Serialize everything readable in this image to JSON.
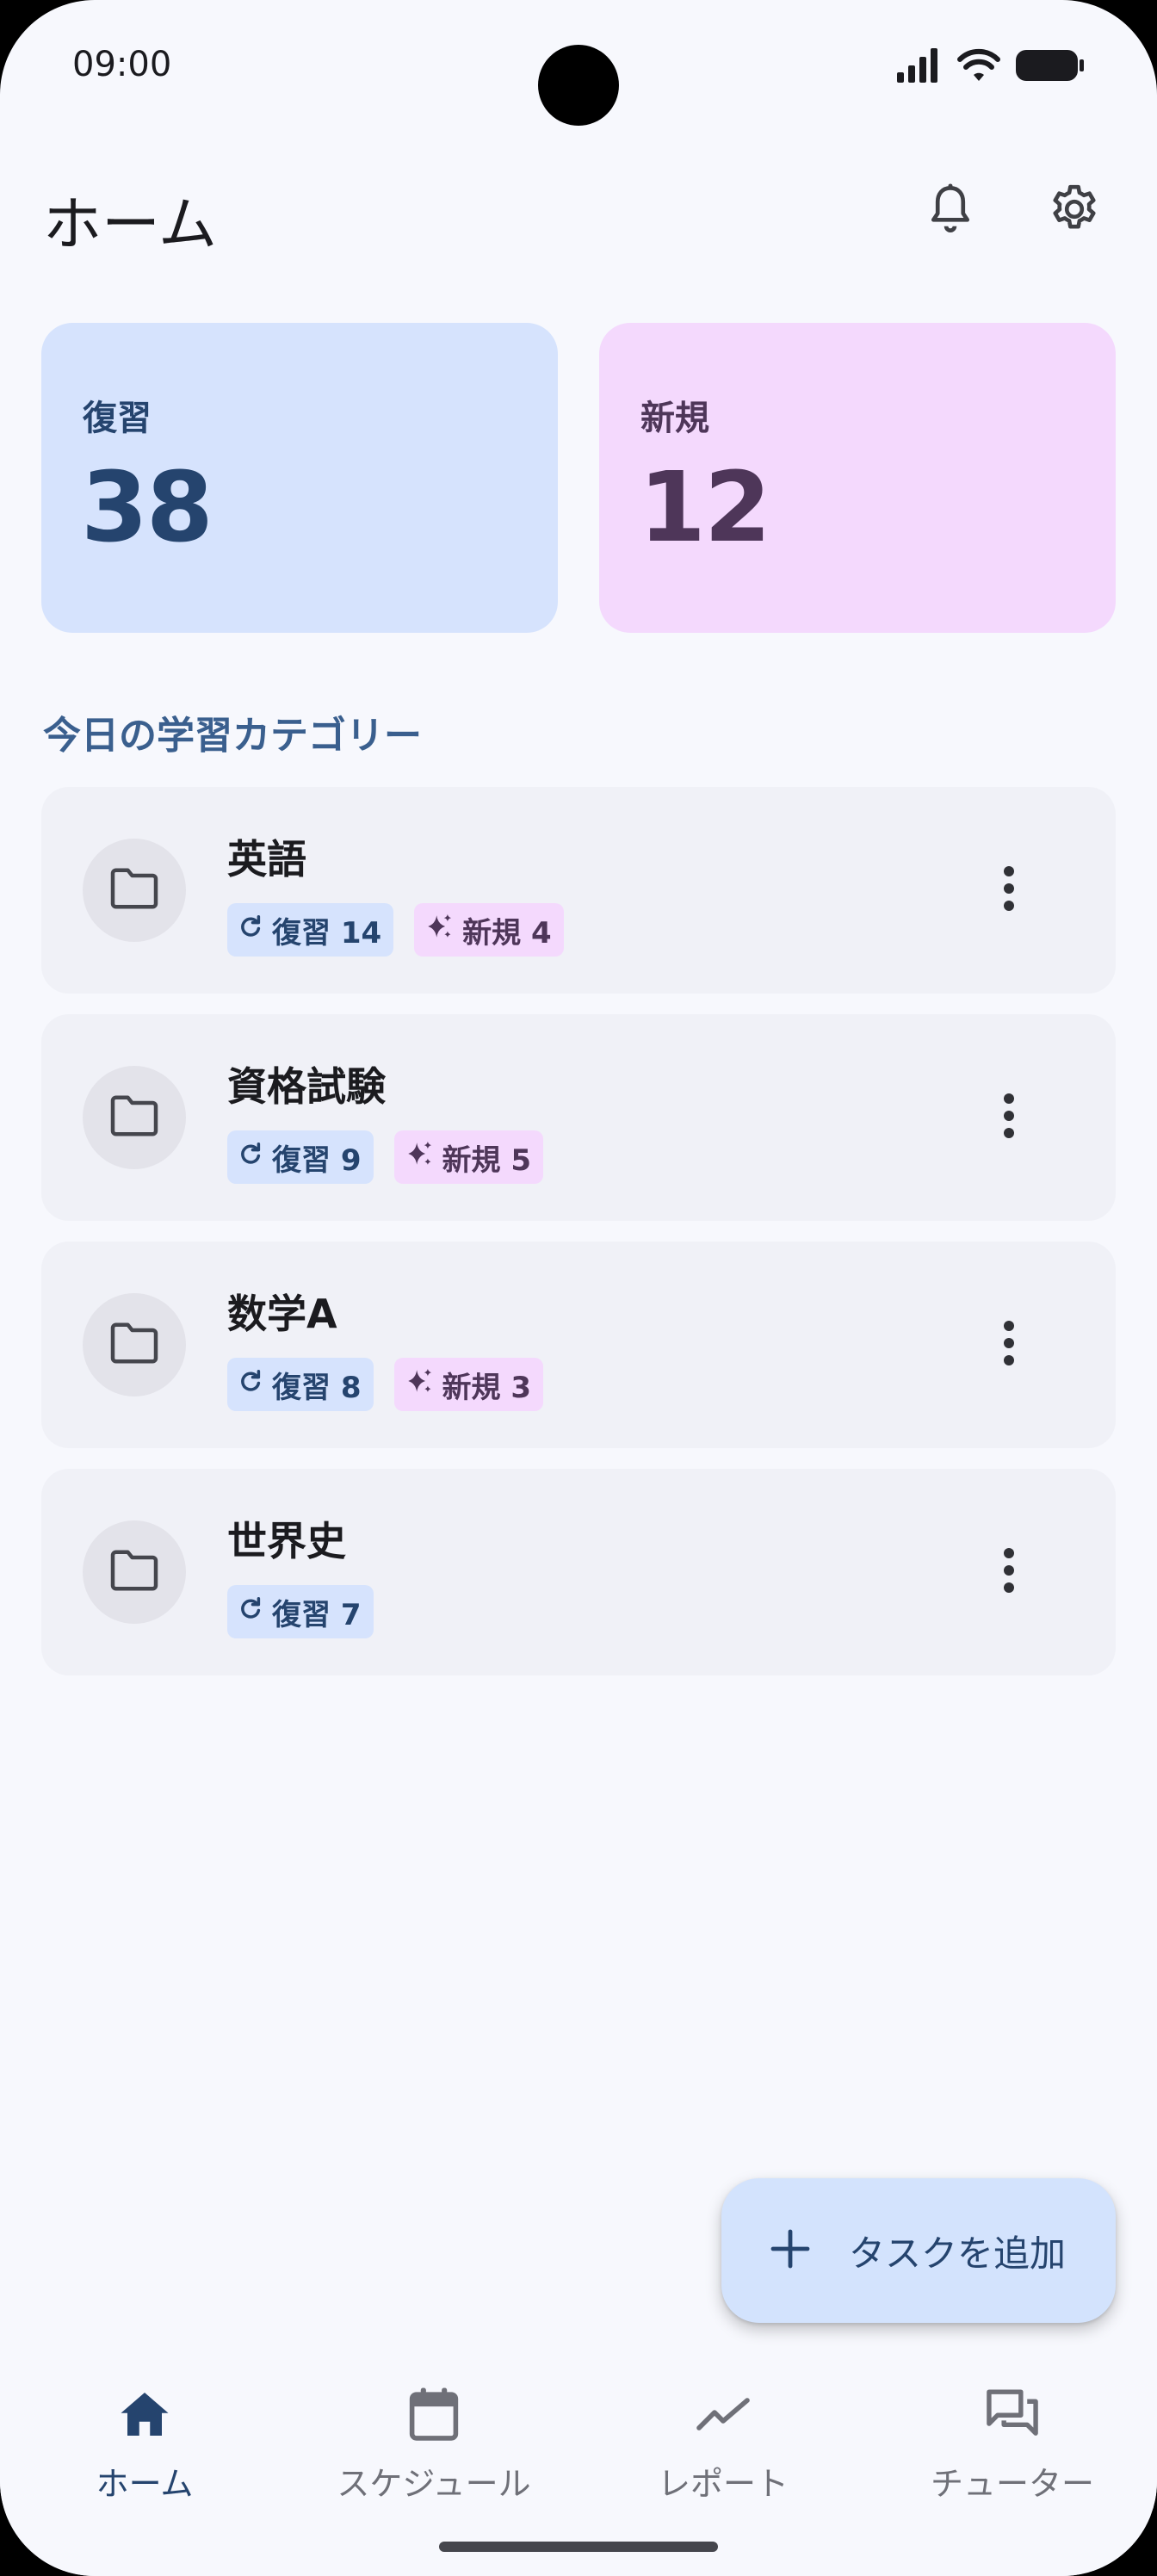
{
  "status_bar": {
    "time": "09:00"
  },
  "header": {
    "title": "ホーム",
    "notifications_icon": "bell-icon",
    "settings_icon": "gear-icon"
  },
  "summary": {
    "review": {
      "label": "復習",
      "value": "38",
      "color": "#d6e3fd"
    },
    "new": {
      "label": "新規",
      "value": "12",
      "color": "#f4d9fd"
    }
  },
  "section_title": "今日の学習カテゴリー",
  "categories": [
    {
      "name": "英語",
      "review_label": "復習 14",
      "new_label": "新規 4"
    },
    {
      "name": "資格試験",
      "review_label": "復習 9",
      "new_label": "新規 5"
    },
    {
      "name": "数学A",
      "review_label": "復習 8",
      "new_label": "新規 3"
    },
    {
      "name": "世界史",
      "review_label": "復習 7"
    }
  ],
  "fab": {
    "label": "タスクを追加",
    "icon": "plus-icon"
  },
  "nav": [
    {
      "label": "ホーム",
      "icon": "home-icon",
      "active": true
    },
    {
      "label": "スケジュール",
      "icon": "calendar-icon"
    },
    {
      "label": "レポート",
      "icon": "trending-icon"
    },
    {
      "label": "チューター",
      "icon": "chat-icon"
    }
  ],
  "colors": {
    "accent": "#25446e",
    "background": "#f7f8fd",
    "new_accent": "#4e3659"
  }
}
